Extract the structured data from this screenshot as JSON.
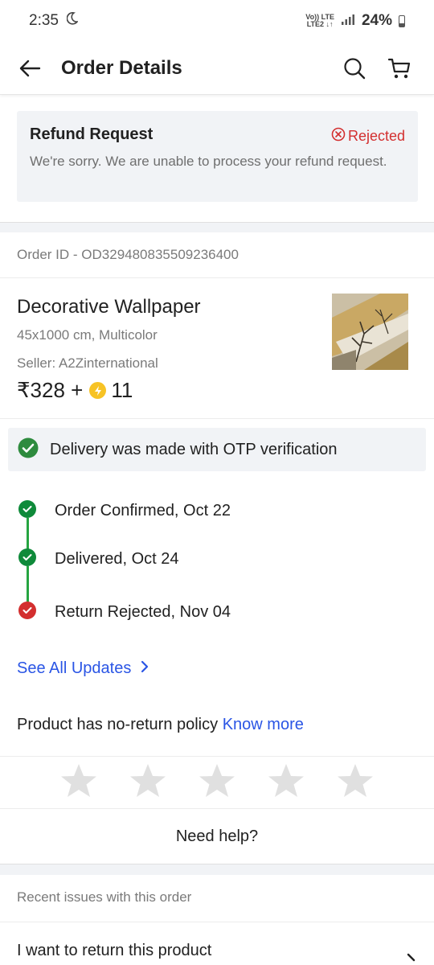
{
  "status_bar": {
    "time": "2:35",
    "network_top": "Vo)) LTE",
    "network_bottom": "LTE2 ↓↑",
    "battery": "24%"
  },
  "header": {
    "title": "Order Details"
  },
  "refund": {
    "title": "Refund Request",
    "status": "Rejected",
    "message": "We're sorry. We are unable to process your refund request."
  },
  "order": {
    "id_text": "Order ID - OD329480835509236400"
  },
  "product": {
    "name": "Decorative Wallpaper",
    "variant": "45x1000 cm, Multicolor",
    "seller": "Seller: A2Zinternational",
    "price": "₹328 +",
    "coins": "11"
  },
  "otp": {
    "message": "Delivery was made with OTP verification"
  },
  "timeline": [
    {
      "label": "Order Confirmed, Oct 22",
      "status": "done"
    },
    {
      "label": "Delivered, Oct 24",
      "status": "done"
    },
    {
      "label": "Return Rejected, Nov 04",
      "status": "rejected"
    }
  ],
  "links": {
    "see_all": "See All Updates",
    "policy_text": "Product has no-return policy",
    "know_more": "Know more"
  },
  "rating": {
    "stars_total": 5,
    "stars_filled": 0
  },
  "help": {
    "label": "Need help?"
  },
  "recent_issues": {
    "heading": "Recent issues with this order",
    "items": [
      "I want to return this product"
    ]
  },
  "colors": {
    "accent_blue": "#2a55e5",
    "success_green": "#26a541",
    "error_red": "#d32f2f",
    "panel_grey": "#f1f3f6"
  }
}
